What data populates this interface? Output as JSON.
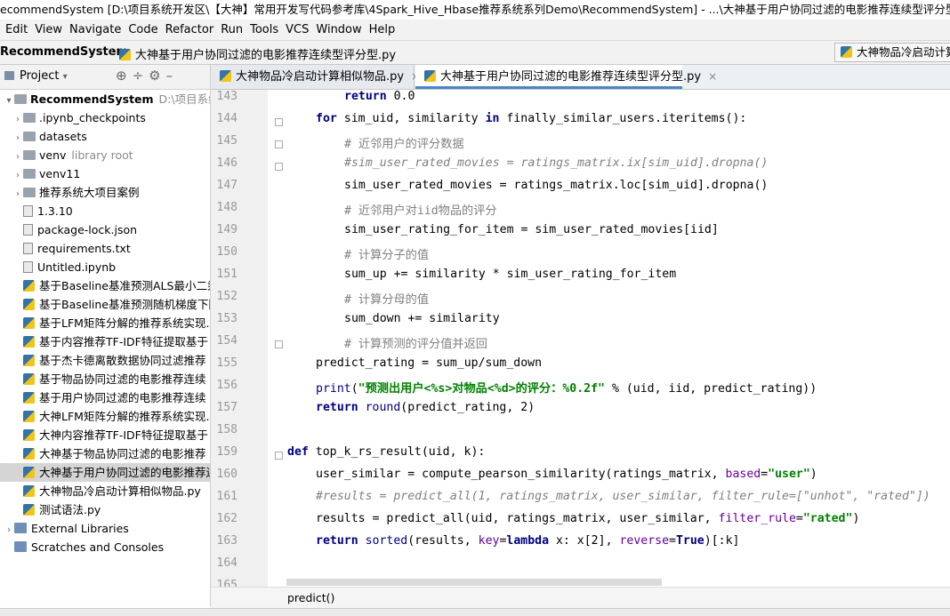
{
  "window": {
    "title": "ecommendSystem [D:\\项目系统开发区\\【大神】常用开发写代码参考库\\4Spark_Hive_Hbase推荐系统系列Demo\\RecommendSystem] - ...\\大神基于用户协同过滤的电影推荐连续型评分型.py [Recc"
  },
  "menu": [
    "Edit",
    "View",
    "Navigate",
    "Code",
    "Refactor",
    "Run",
    "Tools",
    "VCS",
    "Window",
    "Help"
  ],
  "nav": {
    "root": "RecommendSystem",
    "file": "大神基于用户协同过滤的电影推荐连续型评分型.py",
    "run_config": "大神物品冷启动计算"
  },
  "project_panel": {
    "title": "Project",
    "items": [
      {
        "label": "RecommendSystem",
        "extra": "D:\\项目系统开",
        "type": "module",
        "arrow": "▾",
        "indent": 0,
        "bold": true
      },
      {
        "label": ".ipynb_checkpoints",
        "type": "folder",
        "arrow": "›",
        "indent": 1
      },
      {
        "label": "datasets",
        "type": "folder",
        "arrow": "›",
        "indent": 1
      },
      {
        "label": "venv",
        "extra": "library root",
        "type": "folder",
        "arrow": "›",
        "indent": 1
      },
      {
        "label": "venv11",
        "type": "folder",
        "arrow": "›",
        "indent": 1
      },
      {
        "label": "推荐系统大项目案例",
        "type": "folder",
        "arrow": "›",
        "indent": 1
      },
      {
        "label": "1.3.10",
        "type": "file",
        "indent": 1
      },
      {
        "label": "package-lock.json",
        "type": "file",
        "indent": 1
      },
      {
        "label": "requirements.txt",
        "type": "file",
        "indent": 1
      },
      {
        "label": "Untitled.ipynb",
        "type": "file",
        "indent": 1
      },
      {
        "label": "基于Baseline基准预测ALS最小二乘",
        "type": "py",
        "indent": 1
      },
      {
        "label": "基于Baseline基准预测随机梯度下降",
        "type": "py",
        "indent": 1
      },
      {
        "label": "基于LFM矩阵分解的推荐系统实现.",
        "type": "py",
        "indent": 1
      },
      {
        "label": "基于内容推荐TF-IDF特征提取基于",
        "type": "py",
        "indent": 1
      },
      {
        "label": "基于杰卡德离散数据协同过滤推荐",
        "type": "py",
        "indent": 1
      },
      {
        "label": "基于物品协同过滤的电影推荐连续",
        "type": "py",
        "indent": 1
      },
      {
        "label": "基于用户协同过滤的电影推荐连续",
        "type": "py",
        "indent": 1
      },
      {
        "label": "大神LFM矩阵分解的推荐系统实现.",
        "type": "py",
        "indent": 1
      },
      {
        "label": "大神内容推荐TF-IDF特征提取基于",
        "type": "py",
        "indent": 1
      },
      {
        "label": "大神基于物品协同过滤的电影推荐",
        "type": "py",
        "indent": 1
      },
      {
        "label": "大神基于用户协同过滤的电影推荐连",
        "type": "py",
        "indent": 1,
        "selected": true
      },
      {
        "label": "大神物品冷启动计算相似物品.py",
        "type": "py",
        "indent": 1
      },
      {
        "label": "测试语法.py",
        "type": "py",
        "indent": 1
      },
      {
        "label": "External Libraries",
        "type": "lib",
        "arrow": "›",
        "indent": 0
      },
      {
        "label": "Scratches and Consoles",
        "type": "lib",
        "indent": 0
      }
    ]
  },
  "tabs": [
    {
      "label": "大神物品冷启动计算相似物品.py",
      "active": false
    },
    {
      "label": "大神基于用户协同过滤的电影推荐连续型评分型.py",
      "active": true
    }
  ],
  "editor": {
    "lines": [
      {
        "n": "143",
        "indent": 8,
        "parts": [
          [
            "kw",
            "return"
          ],
          [
            "",
            " 0.0"
          ]
        ]
      },
      {
        "n": "144",
        "indent": 4,
        "parts": [
          [
            "kw",
            "for"
          ],
          [
            "",
            " sim_uid, similarity "
          ],
          [
            "kw",
            "in"
          ],
          [
            "",
            " finally_similar_users.iteritems():"
          ]
        ]
      },
      {
        "n": "145",
        "indent": 8,
        "parts": [
          [
            "cm",
            "# 近邻用户的评分数据"
          ]
        ]
      },
      {
        "n": "146",
        "indent": 8,
        "parts": [
          [
            "cmi",
            "#sim_user_rated_movies = ratings_matrix.ix[sim_uid].dropna()"
          ]
        ]
      },
      {
        "n": "147",
        "indent": 8,
        "parts": [
          [
            "",
            "sim_user_rated_movies = ratings_matrix.loc[sim_uid].dropna()"
          ]
        ]
      },
      {
        "n": "148",
        "indent": 8,
        "parts": [
          [
            "cm",
            "# 近邻用户对iid物品的评分"
          ]
        ]
      },
      {
        "n": "149",
        "indent": 8,
        "parts": [
          [
            "",
            "sim_user_rating_for_item = sim_user_rated_movies[iid]"
          ]
        ]
      },
      {
        "n": "150",
        "indent": 8,
        "parts": [
          [
            "cm",
            "# 计算分子的值"
          ]
        ]
      },
      {
        "n": "151",
        "indent": 8,
        "parts": [
          [
            "",
            "sum_up += similarity * sim_user_rating_for_item"
          ]
        ]
      },
      {
        "n": "152",
        "indent": 8,
        "parts": [
          [
            "cm",
            "# 计算分母的值"
          ]
        ]
      },
      {
        "n": "153",
        "indent": 8,
        "parts": [
          [
            "",
            "sum_down += similarity"
          ]
        ]
      },
      {
        "n": "154",
        "indent": 8,
        "parts": [
          [
            "cm",
            "# 计算预测的评分值并返回"
          ]
        ]
      },
      {
        "n": "155",
        "indent": 4,
        "parts": [
          [
            "",
            "predict_rating = sum_up/sum_down"
          ]
        ]
      },
      {
        "n": "156",
        "indent": 4,
        "parts": [
          [
            "nb",
            "print"
          ],
          [
            "",
            "("
          ],
          [
            "st",
            "\"预测出用户<%s>对物品<%d>的评分：%0.2f\""
          ],
          [
            "",
            " % (uid, iid, predict_rating))"
          ]
        ]
      },
      {
        "n": "157",
        "indent": 4,
        "parts": [
          [
            "kw",
            "return"
          ],
          [
            "nb",
            " round"
          ],
          [
            "",
            "(predict_rating, 2)"
          ]
        ]
      },
      {
        "n": "158",
        "indent": 0,
        "parts": []
      },
      {
        "n": "159",
        "indent": 0,
        "parts": [
          [
            "kw",
            "def"
          ],
          [
            "",
            " top_k_rs_result(uid, k):"
          ]
        ]
      },
      {
        "n": "160",
        "indent": 4,
        "parts": [
          [
            "",
            "user_similar = compute_pearson_similarity(ratings_matrix, "
          ],
          [
            "kp",
            "based"
          ],
          [
            "",
            "="
          ],
          [
            "st",
            "\"user\""
          ],
          [
            "",
            ")"
          ]
        ]
      },
      {
        "n": "161",
        "indent": 4,
        "parts": [
          [
            "cmi",
            "#results = predict_all(1, ratings_matrix, user_similar, filter_rule=[\"unhot\", \"rated\"])"
          ]
        ]
      },
      {
        "n": "162",
        "indent": 4,
        "parts": [
          [
            "",
            "results = predict_all(uid, ratings_matrix, user_similar, "
          ],
          [
            "kp",
            "filter_rule"
          ],
          [
            "",
            "="
          ],
          [
            "st",
            "\"rated\""
          ],
          [
            "",
            ")"
          ]
        ]
      },
      {
        "n": "163",
        "indent": 4,
        "parts": [
          [
            "kw",
            "return"
          ],
          [
            "nb",
            " sorted"
          ],
          [
            "",
            "(results, "
          ],
          [
            "kp",
            "key"
          ],
          [
            "",
            "="
          ],
          [
            "kw",
            "lambda"
          ],
          [
            "",
            " x: x[2], "
          ],
          [
            "kp",
            "reverse"
          ],
          [
            "",
            "="
          ],
          [
            "kw",
            "True"
          ],
          [
            "",
            ")[:k]"
          ]
        ]
      },
      {
        "n": "164",
        "indent": 0,
        "parts": []
      },
      {
        "n": "165",
        "indent": 0,
        "parts": []
      }
    ]
  },
  "breadcrumb_bottom": "predict()"
}
